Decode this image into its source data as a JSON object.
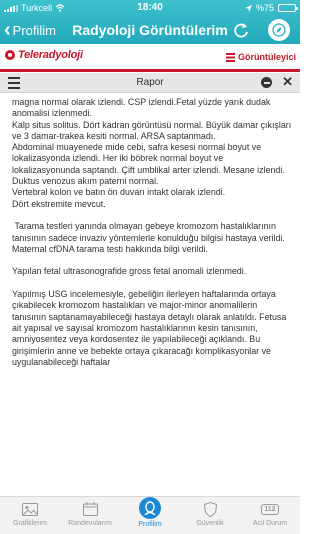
{
  "status_bar": {
    "carrier": "Turkcell",
    "time": "18:40",
    "battery_percent_label": "%75",
    "battery_level": 0.75
  },
  "nav": {
    "back_label": "Profilim",
    "title": "Radyoloji Görüntülerim",
    "refresh_icon": "refresh-icon",
    "compass_icon": "compass-icon"
  },
  "app_header": {
    "logo_text": "Teleradyoloji",
    "viewer_label": "Görüntüleyici",
    "brand_color": "#c8172c"
  },
  "panel": {
    "title": "Rapor"
  },
  "report": {
    "paragraphs": [
      "magna normal olarak izlendi. CSP izlendi.Fetal yüzde yarık dudak anomalisi izlenmedi.\nKalp situs solitus. Dört kadran görüntüsü normal. Büyük damar çıkışları ve 3 damar-trakea kesiti normal. ARSA saptanmadı.\nAbdominal muayenede mide cebi, safra kesesi normal boyut ve lokalizasyonda izlendi. Her iki böbrek normal boyut ve lokalizasyonunda saptandı. Çift umblikal arter izlendi. Mesane izlendi.\nDuktus venozus akım paterni normal.\nVertebral kolon ve batın ön duvarı intakt olarak izlendi.\nDört ekstremite mevcut.",
      " Tarama testleri yanında olmayan gebeye kromozom hastalıklarının tanısının sadece invaziv yöntemlerle konulduğu bilgisi hastaya verildi. Maternal cfDNA tarama testi hakkında bilgi verildi.",
      "Yapılan fetal ultrasonografide gross fetal anomali izlenmedi.",
      "Yapılmış USG incelemesiyle, gebeliğin ilerleyen haftalarında ortaya çıkabilecek kromozom hastalıkları ve major-minor anomalilerin tanısının saptanamayabileceği hastaya detaylı olarak anlatıldı. Fetusa ait yapısal ve sayısal kromozom hastalıklarının kesin tanısının, amniyosentez veya kordosentez ile yapılabileceği açıklandı. Bu girişimlerin anne ve bebekte ortaya çıkaracağı komplikasyonlar ve uygulanabileceği haftalar"
    ]
  },
  "tabs": [
    {
      "label": "Grafiklerim",
      "icon": "image-icon",
      "active": false
    },
    {
      "label": "Randevularım",
      "icon": "calendar-icon",
      "active": false
    },
    {
      "label": "Profilim",
      "icon": "user-icon",
      "active": true
    },
    {
      "label": "Güvenlik",
      "icon": "shield-icon",
      "active": false
    },
    {
      "label": "Acil Durum",
      "icon": "emergency-112-icon",
      "badge_text": "112",
      "active": false
    }
  ],
  "colors": {
    "teal": "#22a9bb",
    "active_tab": "#1e88d6",
    "inactive_tab": "#9a9a9a"
  }
}
